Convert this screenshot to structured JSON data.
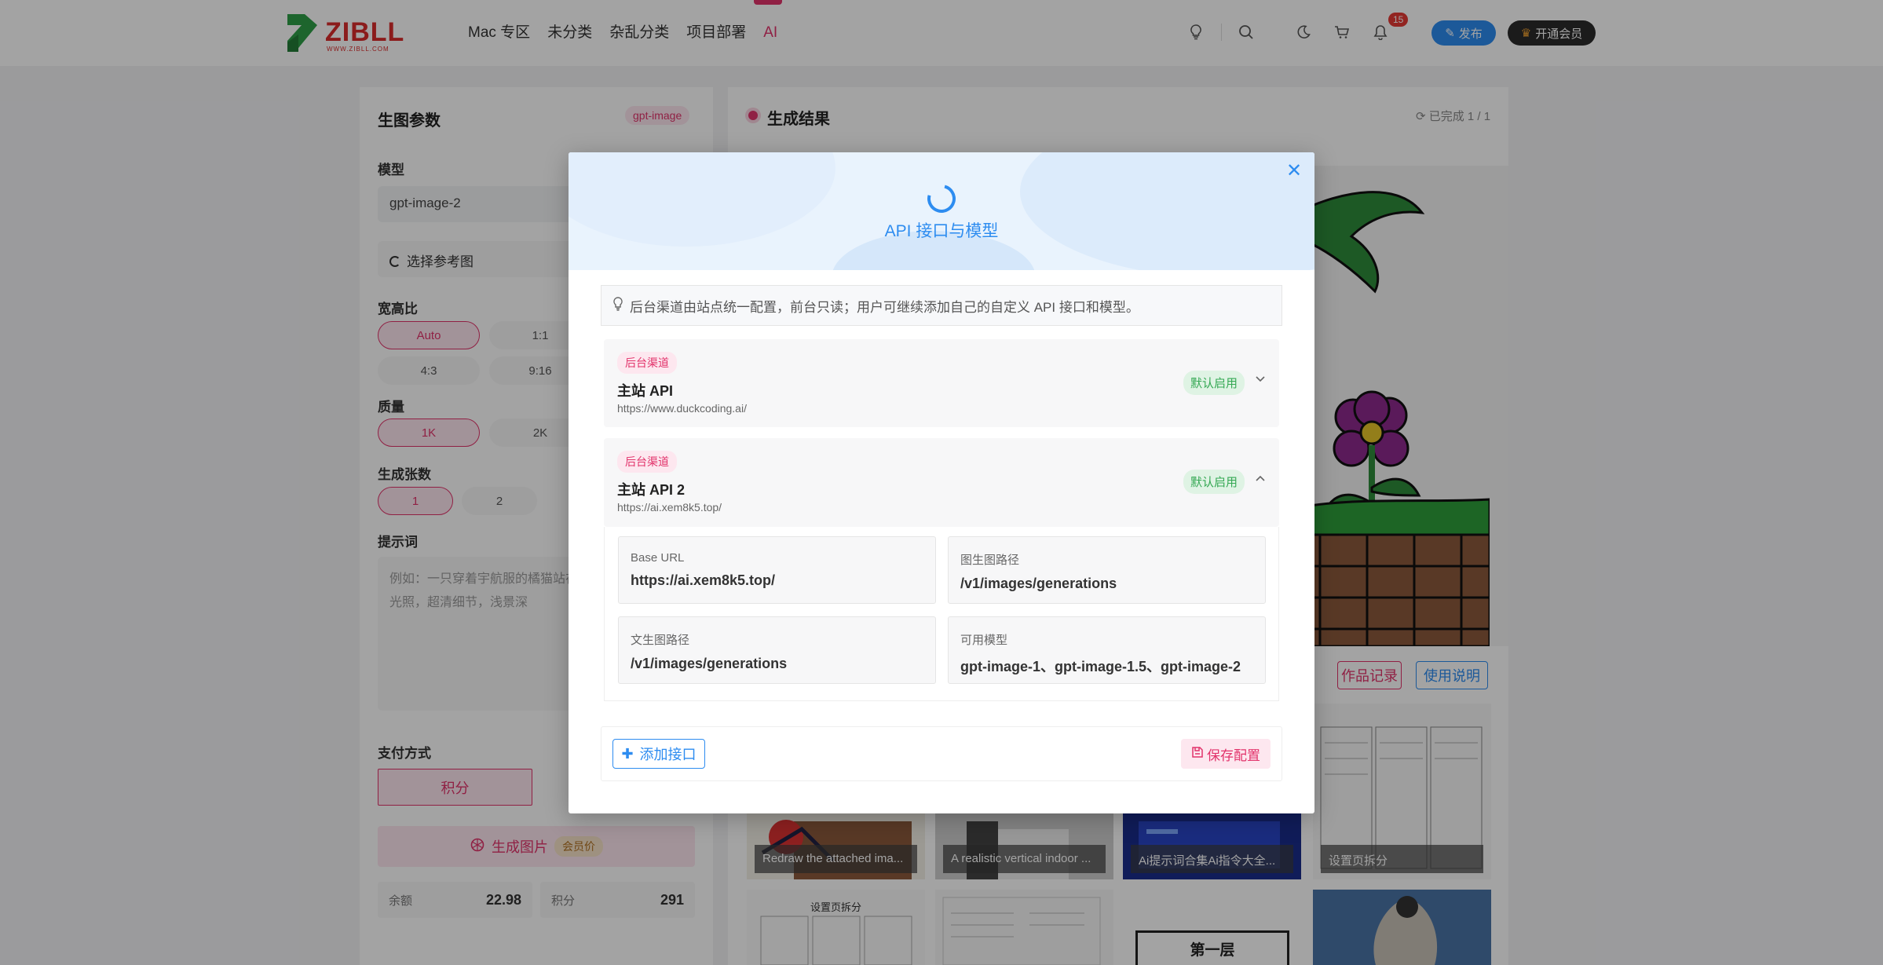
{
  "header": {
    "logo_text": "ZIBLL",
    "logo_sub": "WWW.ZIBLL.COM",
    "nav": [
      "Mac 专区",
      "未分类",
      "杂乱分类",
      "项目部署",
      "AI"
    ],
    "notification_count": "15",
    "publish_label": "发布",
    "vip_label": "开通会员",
    "icons": [
      "lightbulb-icon",
      "search-icon",
      "moon-icon",
      "cart-icon",
      "bell-icon"
    ]
  },
  "left": {
    "title": "生图参数",
    "model_tag": "gpt-image",
    "model_label": "模型",
    "model_value": "gpt-image-2",
    "ref_label": "选择参考图",
    "ratio_label": "宽高比",
    "ratios": [
      "Auto",
      "1:1",
      "4:3",
      "9:16"
    ],
    "quality_label": "质量",
    "qualities": [
      "1K",
      "2K"
    ],
    "count_label": "生成张数",
    "counts": [
      "1",
      "2"
    ],
    "prompt_label": "提示词",
    "prompt_placeholder": "例如：一只穿着宇航服的橘猫站在月球表面，电影感光照，超清细节，浅景深",
    "pay_label": "支付方式",
    "pay_method": "积分",
    "generate_label": "生成图片",
    "vip_price": "会员价",
    "balance_label": "余额",
    "balance_value": "22.98",
    "points_label": "积分",
    "points_value": "291"
  },
  "right": {
    "title": "生成结果",
    "status": "已完成 1 / 1",
    "works_label": "作品记录",
    "help_label": "使用说明",
    "thumbs": [
      {
        "caption": "Redraw the attached ima..."
      },
      {
        "caption": "A realistic vertical indoor ..."
      },
      {
        "caption": "Ai提示词合集Ai指令大全..."
      },
      {
        "caption": "设置页拆分"
      }
    ],
    "row2_caption_3": "第一层",
    "row2_title_1": "设置页拆分"
  },
  "modal": {
    "title": "API 接口与模型",
    "notice": "后台渠道由站点统一配置，前台只读；用户可继续添加自己的自定义 API 接口和模型。",
    "channels": [
      {
        "tag": "后台渠道",
        "name": "主站 API",
        "url": "https://www.duckcoding.ai/",
        "badge": "默认启用",
        "expanded": false
      },
      {
        "tag": "后台渠道",
        "name": "主站 API 2",
        "url": "https://ai.xem8k5.top/",
        "badge": "默认启用",
        "expanded": true
      }
    ],
    "detail": {
      "base_url_label": "Base URL",
      "base_url_value": "https://ai.xem8k5.top/",
      "img2img_label": "图生图路径",
      "img2img_value": "/v1/images/generations",
      "txt2img_label": "文生图路径",
      "txt2img_value": "/v1/images/generations",
      "models_label": "可用模型",
      "models_value": "gpt-image-1、gpt-image-1.5、gpt-image-2"
    },
    "add_label": "添加接口",
    "save_label": "保存配置"
  },
  "colors": {
    "accent_pink": "#e2336b",
    "accent_blue": "#2d8cf0",
    "success_green": "#34a853"
  }
}
